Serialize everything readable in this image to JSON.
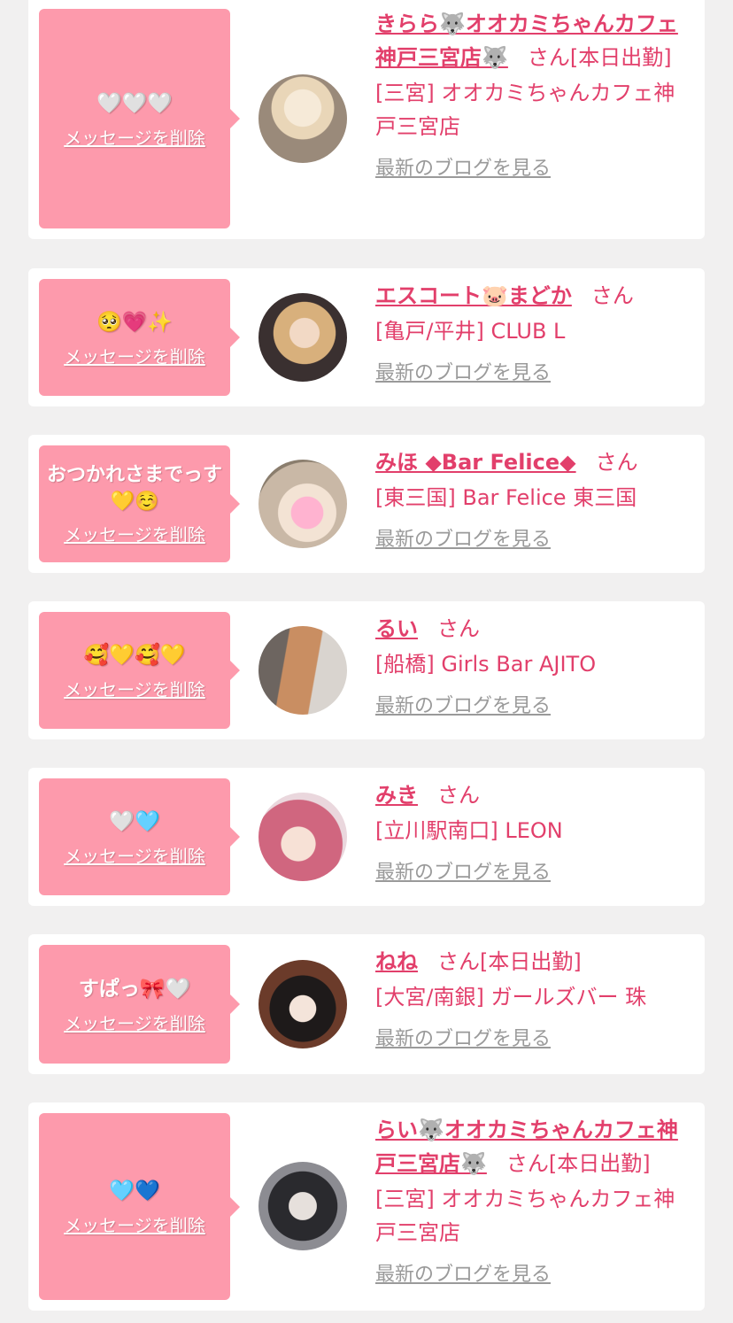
{
  "delete_label": "メッセージを削除",
  "blog_label": "最新のブログを見る",
  "san": "さん",
  "cards": [
    {
      "message": "🤍🤍🤍",
      "name": "きらら🐺オオカミちゃんカフェ神戸三宮店🐺",
      "badge": "[本日出勤]",
      "shop": "[三宮] オオカミちゃんカフェ神戸三宮店"
    },
    {
      "message": "🥺💗✨",
      "name": "エスコート🐷まどか",
      "badge": "",
      "shop": "[亀戸/平井] CLUB L"
    },
    {
      "message": "おつかれさまでっす💛☺️",
      "name": "みほ ◆Bar Felice◆",
      "badge": "",
      "shop": "[東三国] Bar Felice 東三国"
    },
    {
      "message": "🥰💛🥰💛",
      "name": "るい",
      "badge": "",
      "shop": "[船橋] Girls Bar AJITO"
    },
    {
      "message": "🤍🩵",
      "name": "みき",
      "badge": "",
      "shop": "[立川駅南口] LEON"
    },
    {
      "message": "すぱっ🎀🤍",
      "name": "ねね",
      "badge": "[本日出勤]",
      "shop": "[大宮/南銀] ガールズバー 珠"
    },
    {
      "message": "🩵💙",
      "name": "らい🐺オオカミちゃんカフェ神戸三宮店🐺",
      "badge": "[本日出勤]",
      "shop": "[三宮] オオカミちゃんカフェ神戸三宮店"
    }
  ]
}
